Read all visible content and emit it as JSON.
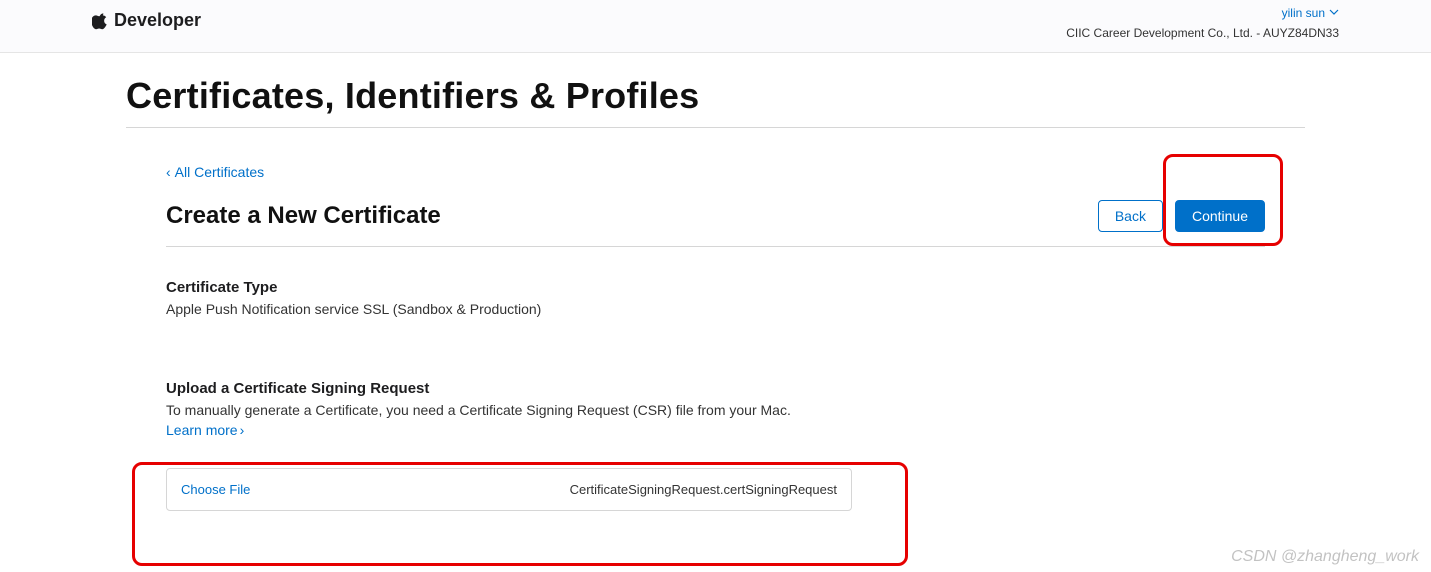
{
  "header": {
    "brand": "Developer",
    "user_name": "yilin sun",
    "company_line": "CIIC Career Development Co., Ltd. - AUYZ84DN33"
  },
  "page": {
    "title": "Certificates, Identifiers & Profiles",
    "breadcrumb_label": "All Certificates",
    "sub_title": "Create a New Certificate",
    "back_label": "Back",
    "continue_label": "Continue"
  },
  "certificate": {
    "type_heading": "Certificate Type",
    "type_desc": "Apple Push Notification service SSL (Sandbox & Production)"
  },
  "upload": {
    "heading": "Upload a Certificate Signing Request",
    "desc": "To manually generate a Certificate, you need a Certificate Signing Request (CSR) file from your Mac.",
    "learn_label": "Learn more",
    "choose_label": "Choose File",
    "file_name": "CertificateSigningRequest.certSigningRequest"
  },
  "watermark": "CSDN @zhangheng_work"
}
